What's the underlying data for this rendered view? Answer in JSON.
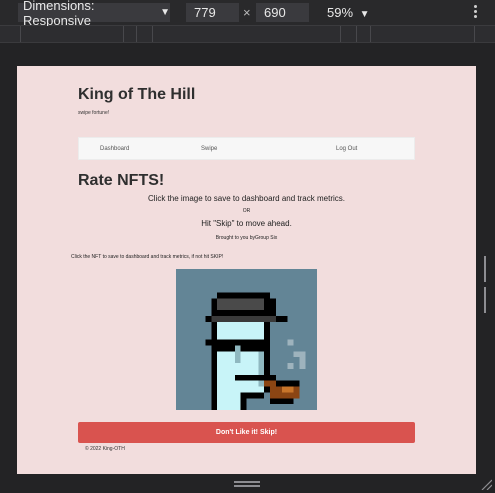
{
  "devtools": {
    "dimensions_label": "Dimensions: Responsive",
    "width_value": "779",
    "times_symbol": "×",
    "height_value": "690",
    "zoom_label": "59%",
    "caret": "▼"
  },
  "site": {
    "title": "King of The Hill",
    "tagline": "swipe fortune!"
  },
  "nav": {
    "items": [
      "Dashboard",
      "Swipe",
      "Log Out"
    ]
  },
  "main": {
    "heading": "Rate NFTS!",
    "instruction1": "Click the image to save to dashboard and track metrics.",
    "or_text": "OR",
    "instruction2": "Hit \"Skip\" to move ahead.",
    "credit": "Brought to you byGroup Six",
    "small_instruction": "Click the NFT to save to dashboard and track metrics, if not hit SKIP!",
    "skip_button": "Don't Like it! Skip!",
    "footer": "© 2022 King-OTH"
  },
  "colors": {
    "page_background": "#f2dddd",
    "skip_button": "#d9534f",
    "nft_background": "#638596"
  }
}
